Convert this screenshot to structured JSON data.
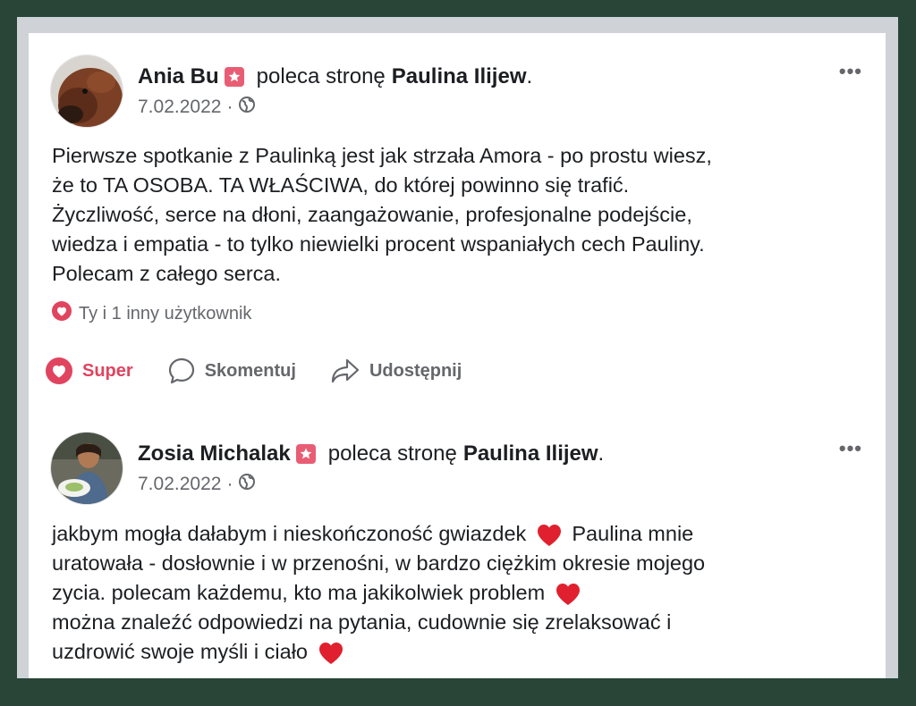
{
  "posts": [
    {
      "author": "Ania Bu",
      "verb": "poleca stronę",
      "page": "Paulina Ilijew",
      "date": "7.02.2022",
      "lines": [
        "Pierwsze spotkanie z Paulinką jest jak strzała Amora - po prostu wiesz,",
        "że to TA OSOBA. TA WŁAŚCIWA, do której powinno się trafić.",
        "Życzliwość, serce na dłoni, zaangażowanie, profesjonalne podejście,",
        "wiedza i empatia - to tylko niewielki procent wspaniałych cech Pauliny.",
        "Polecam z całego serca."
      ],
      "reactions_text": "Ty i 1 inny użytkownik",
      "actions": {
        "like": "Super",
        "comment": "Skomentuj",
        "share": "Udostępnij"
      }
    },
    {
      "author": "Zosia Michalak",
      "verb": "poleca stronę",
      "page": "Paulina Ilijew",
      "date": "7.02.2022",
      "lines": [
        "jakbym mogła dałabym i nieskończoność gwiazdek",
        "Paulina mnie",
        "uratowała - dosłownie i w przenośni, w bardzo ciężkim okresie mojego",
        "zycia. polecam każdemu, kto ma jakikolwiek problem",
        "można znaleźć odpowiedzi na pytania, cudownie się zrelaksować i",
        "uzdrowić swoje myśli i ciało"
      ]
    }
  ],
  "punctuation": ".",
  "separator": "·",
  "more_label": "•••",
  "colors": {
    "accent": "#e0445f",
    "badge": "#e85d74",
    "background": "#284537"
  }
}
